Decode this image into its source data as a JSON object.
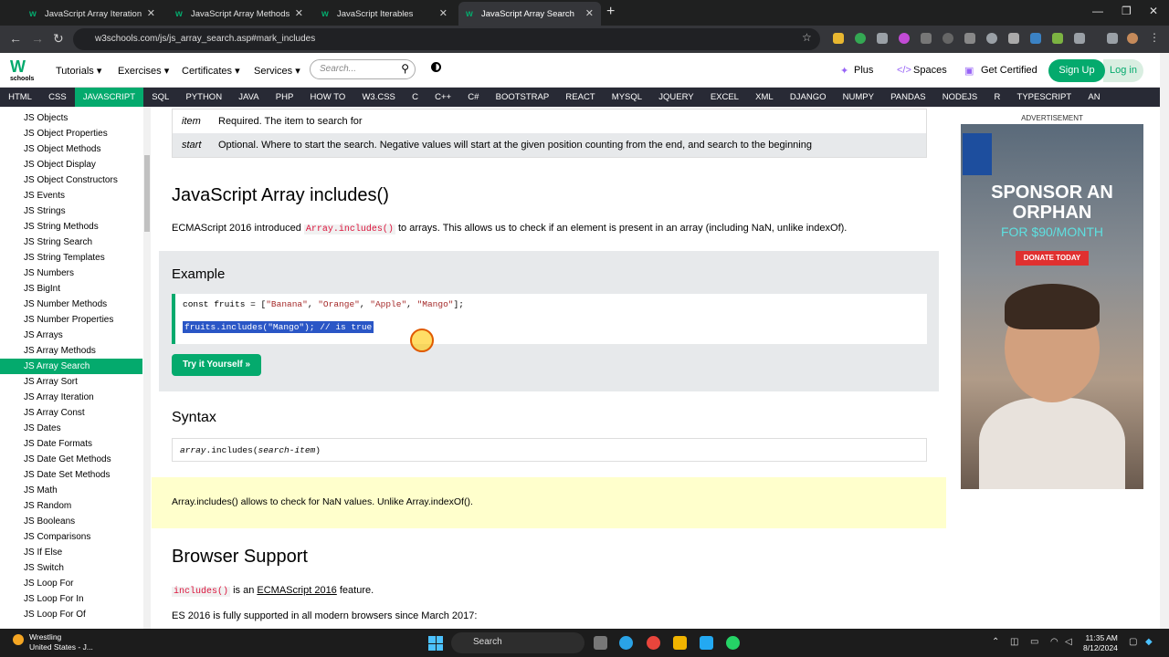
{
  "browser": {
    "tabs": [
      {
        "label": "JavaScript Array Iteration"
      },
      {
        "label": "JavaScript Array Methods"
      },
      {
        "label": "JavaScript Iterables"
      },
      {
        "label": "JavaScript Array Search"
      }
    ],
    "url": "w3schools.com/js/js_array_search.asp#mark_includes"
  },
  "header": {
    "logo": "W",
    "logo_sub": "schools",
    "menus": [
      "Tutorials ▾",
      "Exercises ▾",
      "Certificates ▾",
      "Services ▾"
    ],
    "search_placeholder": "Search...",
    "plus": "Plus",
    "spaces": "Spaces",
    "get_certified": "Get Certified",
    "signup": "Sign Up",
    "login": "Log in"
  },
  "topnav": [
    "HTML",
    "CSS",
    "JAVASCRIPT",
    "SQL",
    "PYTHON",
    "JAVA",
    "PHP",
    "HOW TO",
    "W3.CSS",
    "C",
    "C++",
    "C#",
    "BOOTSTRAP",
    "REACT",
    "MYSQL",
    "JQUERY",
    "EXCEL",
    "XML",
    "DJANGO",
    "NUMPY",
    "PANDAS",
    "NODEJS",
    "R",
    "TYPESCRIPT",
    "AN"
  ],
  "sidebar": [
    "JS Objects",
    "JS Object Properties",
    "JS Object Methods",
    "JS Object Display",
    "JS Object Constructors",
    "JS Events",
    "JS Strings",
    "JS String Methods",
    "JS String Search",
    "JS String Templates",
    "JS Numbers",
    "JS BigInt",
    "JS Number Methods",
    "JS Number Properties",
    "JS Arrays",
    "JS Array Methods",
    "JS Array Search",
    "JS Array Sort",
    "JS Array Iteration",
    "JS Array Const",
    "JS Dates",
    "JS Date Formats",
    "JS Date Get Methods",
    "JS Date Set Methods",
    "JS Math",
    "JS Random",
    "JS Booleans",
    "JS Comparisons",
    "JS If Else",
    "JS Switch",
    "JS Loop For",
    "JS Loop For In",
    "JS Loop For Of"
  ],
  "params": [
    {
      "name": "item",
      "desc": "Required. The item to search for"
    },
    {
      "name": "start",
      "desc": "Optional. Where to start the search. Negative values will start at the given position counting from the end, and search to the beginning"
    }
  ],
  "section": {
    "title": "JavaScript Array includes()",
    "intro_a": "ECMAScript 2016 introduced ",
    "intro_kw": "Array.includes()",
    "intro_b": " to arrays. This allows us to check if an element is present in an array (including NaN, unlike indexOf)."
  },
  "example": {
    "title": "Example",
    "line1_a": "const fruits = [",
    "s1": "\"Banana\"",
    "s2": "\"Orange\"",
    "s3": "\"Apple\"",
    "s4": "\"Mango\"",
    "line1_b": "];",
    "line2": "fruits.includes(\"Mango\"); // is true",
    "try_button": "Try it Yourself »"
  },
  "syntax": {
    "title": "Syntax",
    "obj": "array",
    "method": ".includes(",
    "arg": "search-item",
    "close": ")"
  },
  "note": "Array.includes() allows to check for NaN values. Unlike Array.indexOf().",
  "support": {
    "title": "Browser Support",
    "kw": "includes()",
    "text_a": " is an ",
    "link": "ECMAScript 2016",
    "text_b": " feature.",
    "line2": "ES 2016 is fully supported in all modern browsers since March 2017:"
  },
  "ad": {
    "label": "ADVERTISEMENT",
    "headline": "SPONSOR AN ORPHAN",
    "sub": "FOR $90/MONTH",
    "button": "DONATE TODAY"
  },
  "taskbar": {
    "weather_title": "Wrestling",
    "weather_sub": "United States - J...",
    "search": "Search",
    "time": "11:35 AM",
    "date": "8/12/2024"
  },
  "colors": {
    "brand": "#04aa6d",
    "topnav_bg": "#282a35",
    "note_bg": "#ffffcc"
  }
}
